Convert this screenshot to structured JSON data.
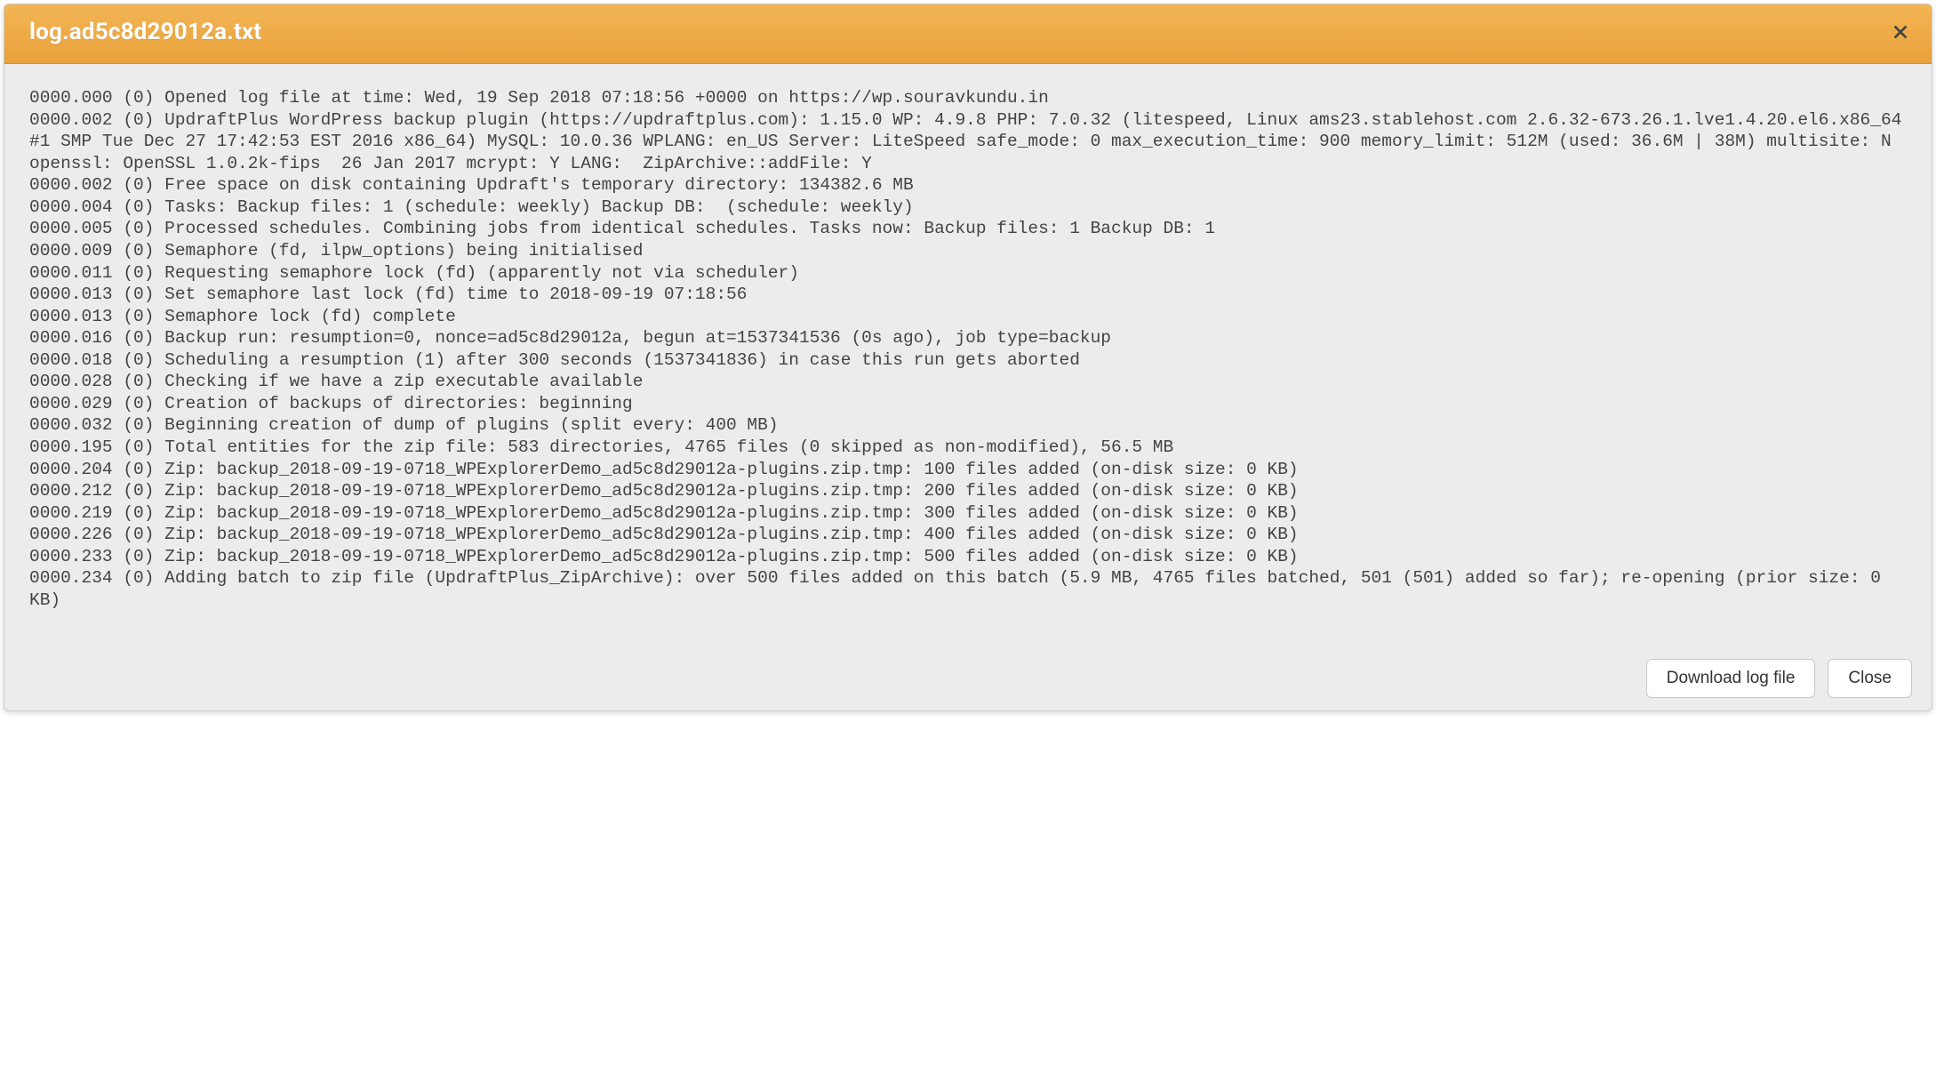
{
  "modal": {
    "title": "log.ad5c8d29012a.txt",
    "log_text": "0000.000 (0) Opened log file at time: Wed, 19 Sep 2018 07:18:56 +0000 on https://wp.souravkundu.in\n0000.002 (0) UpdraftPlus WordPress backup plugin (https://updraftplus.com): 1.15.0 WP: 4.9.8 PHP: 7.0.32 (litespeed, Linux ams23.stablehost.com 2.6.32-673.26.1.lve1.4.20.el6.x86_64 #1 SMP Tue Dec 27 17:42:53 EST 2016 x86_64) MySQL: 10.0.36 WPLANG: en_US Server: LiteSpeed safe_mode: 0 max_execution_time: 900 memory_limit: 512M (used: 36.6M | 38M) multisite: N openssl: OpenSSL 1.0.2k-fips  26 Jan 2017 mcrypt: Y LANG:  ZipArchive::addFile: Y\n0000.002 (0) Free space on disk containing Updraft's temporary directory: 134382.6 MB\n0000.004 (0) Tasks: Backup files: 1 (schedule: weekly) Backup DB:  (schedule: weekly)\n0000.005 (0) Processed schedules. Combining jobs from identical schedules. Tasks now: Backup files: 1 Backup DB: 1\n0000.009 (0) Semaphore (fd, ilpw_options) being initialised\n0000.011 (0) Requesting semaphore lock (fd) (apparently not via scheduler)\n0000.013 (0) Set semaphore last lock (fd) time to 2018-09-19 07:18:56\n0000.013 (0) Semaphore lock (fd) complete\n0000.016 (0) Backup run: resumption=0, nonce=ad5c8d29012a, begun at=1537341536 (0s ago), job type=backup\n0000.018 (0) Scheduling a resumption (1) after 300 seconds (1537341836) in case this run gets aborted\n0000.028 (0) Checking if we have a zip executable available\n0000.029 (0) Creation of backups of directories: beginning\n0000.032 (0) Beginning creation of dump of plugins (split every: 400 MB)\n0000.195 (0) Total entities for the zip file: 583 directories, 4765 files (0 skipped as non-modified), 56.5 MB\n0000.204 (0) Zip: backup_2018-09-19-0718_WPExplorerDemo_ad5c8d29012a-plugins.zip.tmp: 100 files added (on-disk size: 0 KB)\n0000.212 (0) Zip: backup_2018-09-19-0718_WPExplorerDemo_ad5c8d29012a-plugins.zip.tmp: 200 files added (on-disk size: 0 KB)\n0000.219 (0) Zip: backup_2018-09-19-0718_WPExplorerDemo_ad5c8d29012a-plugins.zip.tmp: 300 files added (on-disk size: 0 KB)\n0000.226 (0) Zip: backup_2018-09-19-0718_WPExplorerDemo_ad5c8d29012a-plugins.zip.tmp: 400 files added (on-disk size: 0 KB)\n0000.233 (0) Zip: backup_2018-09-19-0718_WPExplorerDemo_ad5c8d29012a-plugins.zip.tmp: 500 files added (on-disk size: 0 KB)\n0000.234 (0) Adding batch to zip file (UpdraftPlus_ZipArchive): over 500 files added on this batch (5.9 MB, 4765 files batched, 501 (501) added so far); re-opening (prior size: 0 KB)",
    "footer": {
      "download_label": "Download log file",
      "close_label": "Close"
    }
  }
}
